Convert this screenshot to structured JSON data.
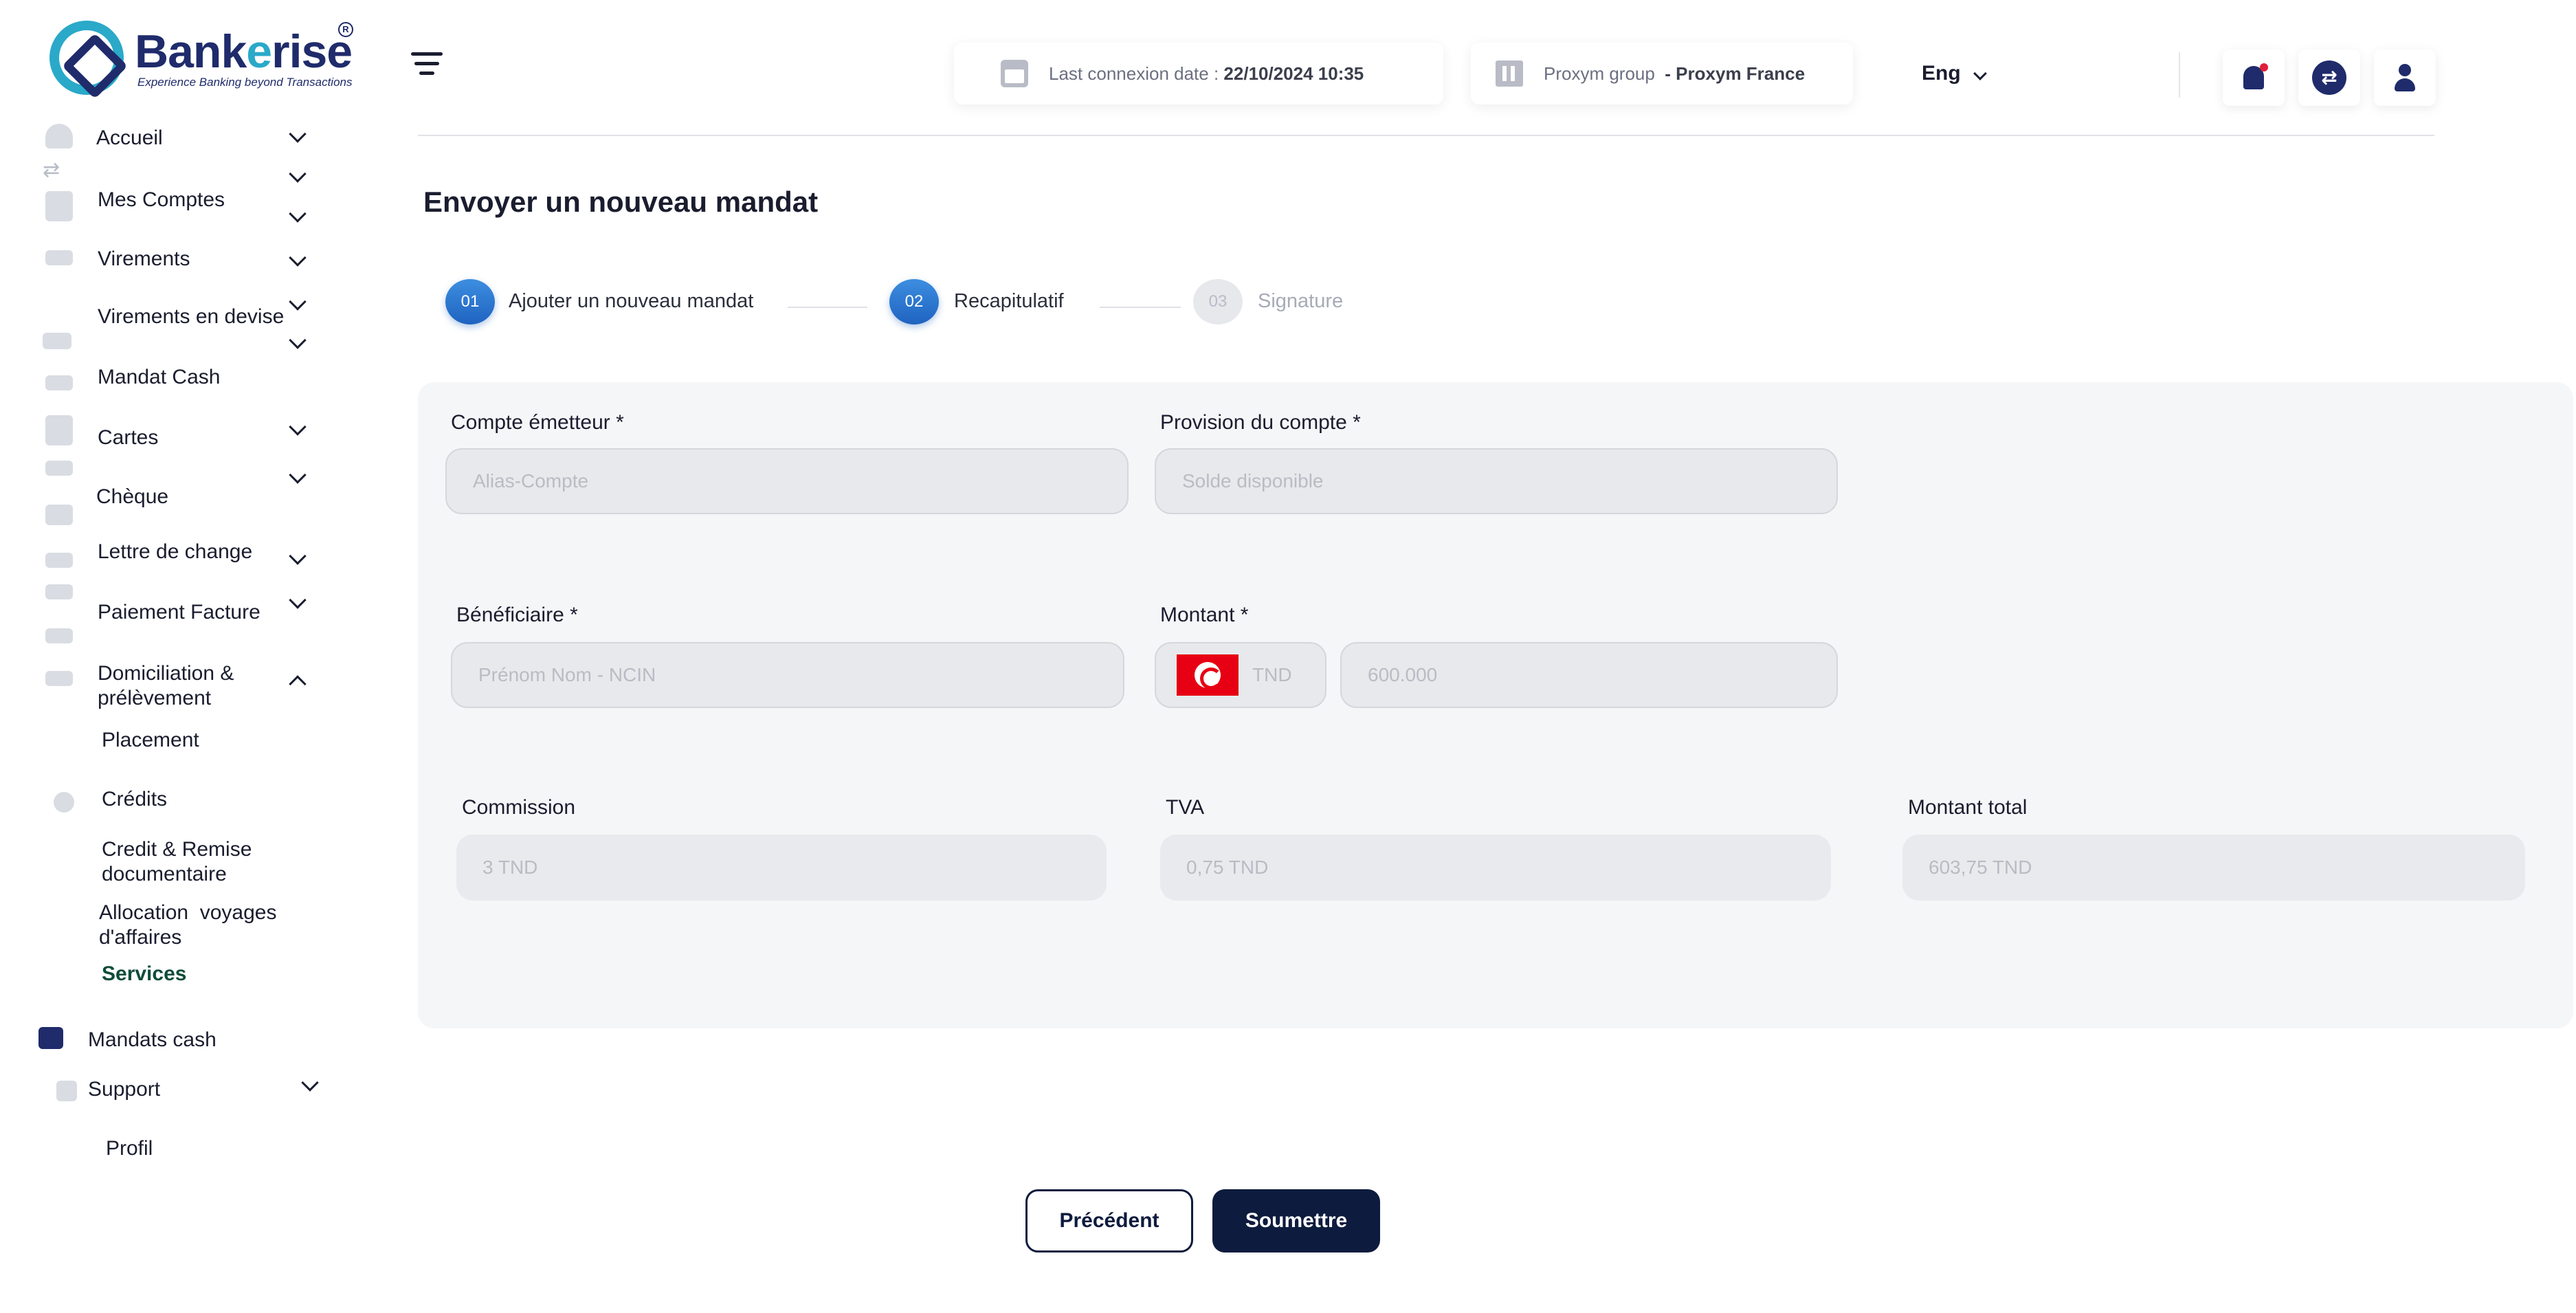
{
  "brand": {
    "name_part1": "Bank",
    "name_part2": "e",
    "name_part3": "rise",
    "tagline": "Experience Banking beyond Transactions",
    "registered": "R"
  },
  "sidebar": {
    "items": [
      {
        "label": "Accueil",
        "icon": "home-icon"
      },
      {
        "label": "Mes Comptes",
        "icon": "wallet-icon"
      },
      {
        "label": "Virements",
        "icon": "envelope-icon"
      },
      {
        "label": "Virements en devise",
        "icon": "transfer-icon"
      },
      {
        "label": "Mandat Cash",
        "icon": "envelope-icon"
      },
      {
        "label": "Cartes",
        "icon": "card-icon"
      },
      {
        "label": "Chèque",
        "icon": "envelope-icon"
      },
      {
        "label": "Lettre de change",
        "icon": "envelope-icon"
      },
      {
        "label": "Paiement Facture",
        "icon": "envelope-icon"
      },
      {
        "label": "Domiciliation & prélèvement",
        "icon": "envelope-icon"
      },
      {
        "label": "Placement",
        "icon": ""
      },
      {
        "label": "Crédits",
        "icon": "person-icon"
      },
      {
        "label": "Credit & Remise documentaire",
        "icon": ""
      },
      {
        "label": "Allocation  voyages d'affaires",
        "icon": ""
      },
      {
        "label": "Services",
        "icon": ""
      },
      {
        "label": "Mandats cash",
        "icon": "envelope-icon"
      },
      {
        "label": "Support",
        "icon": "support-icon"
      },
      {
        "label": "Profil",
        "icon": ""
      }
    ]
  },
  "header": {
    "last_connexion_label": "Last connexion date :",
    "last_connexion_value": "22/10/2024 10:35",
    "group_label": "Proxym group",
    "group_value": "- Proxym France",
    "language": "Eng"
  },
  "main": {
    "title": "Envoyer un nouveau mandat",
    "steps": [
      {
        "number": "01",
        "label": "Ajouter un nouveau mandat",
        "state": "done"
      },
      {
        "number": "02",
        "label": "Recapitulatif",
        "state": "active"
      },
      {
        "number": "03",
        "label": "Signature",
        "state": "pending"
      }
    ],
    "form": {
      "compte_emetteur": {
        "label": "Compte émetteur *",
        "placeholder": "Alias-Compte"
      },
      "provision": {
        "label": "Provision du compte *",
        "placeholder": "Solde disponible"
      },
      "beneficiaire": {
        "label": "Bénéficiaire *",
        "placeholder": "Prénom Nom - NCIN"
      },
      "montant": {
        "label": "Montant *",
        "currency": "TND",
        "value": "600.000"
      },
      "commission": {
        "label": "Commission",
        "value": "3 TND"
      },
      "tva": {
        "label": "TVA",
        "value": "0,75 TND"
      },
      "montant_total": {
        "label": "Montant total",
        "value": "603,75 TND"
      }
    },
    "buttons": {
      "previous": "Précédent",
      "submit": "Soumettre"
    }
  },
  "colors": {
    "brand_dark": "#1f2b6b",
    "brand_light": "#2aa9c9",
    "step_active": "#2a74d0",
    "button_primary": "#0d1b3e",
    "notification_dot": "#e0203a"
  }
}
